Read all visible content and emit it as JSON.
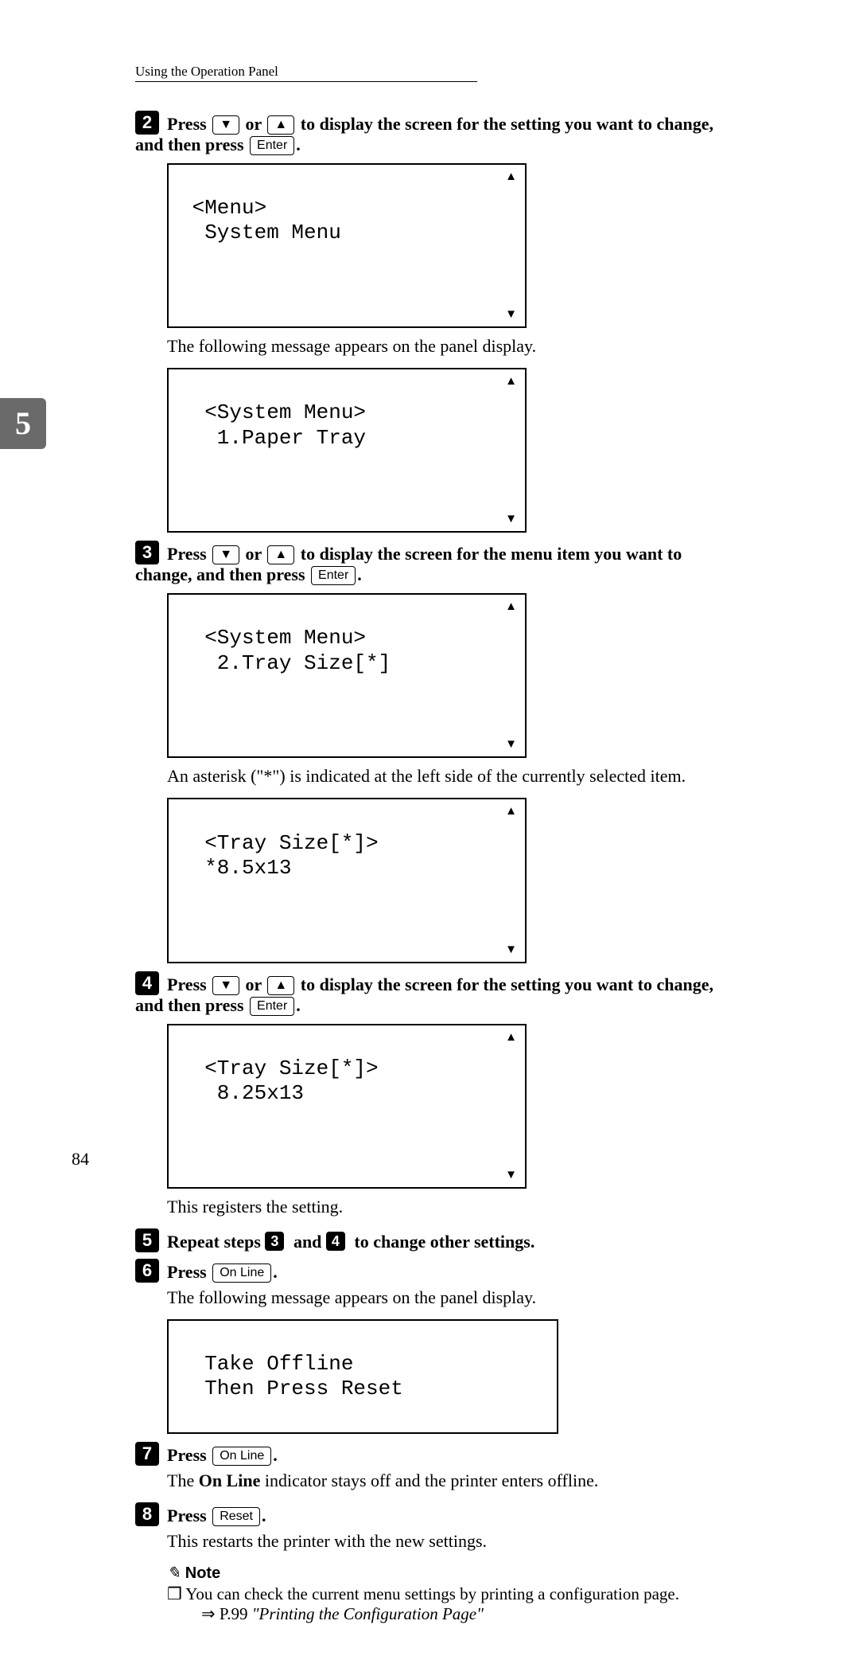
{
  "header": "Using the Operation Panel",
  "tab_number": "5",
  "page_number": "84",
  "keys": {
    "down": "▼",
    "up": "▲",
    "enter": "Enter",
    "online": "On Line",
    "reset": "Reset"
  },
  "steps": {
    "s2": {
      "num": "2",
      "prefix": "Press ",
      "mid": " or ",
      "tail1": " to display the screen for the setting you want to change,",
      "tail2": "and then press ",
      "tail3": "."
    },
    "lcd1": {
      "line1": " <Menu>",
      "line2": "  System Menu"
    },
    "body1": "The following message appears on the panel display.",
    "lcd2": {
      "line1": "  <System Menu>",
      "line2": "   1.Paper Tray"
    },
    "s3": {
      "num": "3",
      "prefix": "Press ",
      "mid": " or ",
      "tail1": " to display the screen for the menu item you want to",
      "tail2": "change, and then press ",
      "tail3": "."
    },
    "lcd3": {
      "line1": "  <System Menu>",
      "line2": "   2.Tray Size[*]"
    },
    "body2": "An asterisk (\"*\") is indicated at the left side of the currently selected item.",
    "lcd4": {
      "line1": "  <Tray Size[*]>",
      "line2": "  *8.5x13"
    },
    "s4": {
      "num": "4",
      "prefix": "Press ",
      "mid": " or ",
      "tail1": " to display the screen for the setting you want to change,",
      "tail2": "and then press ",
      "tail3": "."
    },
    "lcd5": {
      "line1": "  <Tray Size[*]>",
      "line2": "   8.25x13"
    },
    "body3": "This registers the setting.",
    "s5": {
      "num": "5",
      "text_a": "Repeat steps ",
      "text_b": " and ",
      "text_c": " to change other settings.",
      "ref1": "3",
      "ref2": "4"
    },
    "s6": {
      "num": "6",
      "prefix": "Press ",
      "tail": "."
    },
    "body4": "The following message appears on the panel display.",
    "lcd6": {
      "line1": "  Take Offline",
      "line2": "  Then Press Reset"
    },
    "s7": {
      "num": "7",
      "prefix": "Press ",
      "tail": "."
    },
    "body5a": "The ",
    "body5b": "On Line",
    "body5c": " indicator stays off and the printer enters offline.",
    "s8": {
      "num": "8",
      "prefix": "Press ",
      "tail": "."
    },
    "body6": "This restarts the printer with the new settings.",
    "note_head": "Note",
    "note_body_a": "❒ You can check the current menu settings by printing a configuration page.",
    "note_body_b": "⇒ P.99 ",
    "note_body_c": "\"Printing the Configuration Page\""
  }
}
